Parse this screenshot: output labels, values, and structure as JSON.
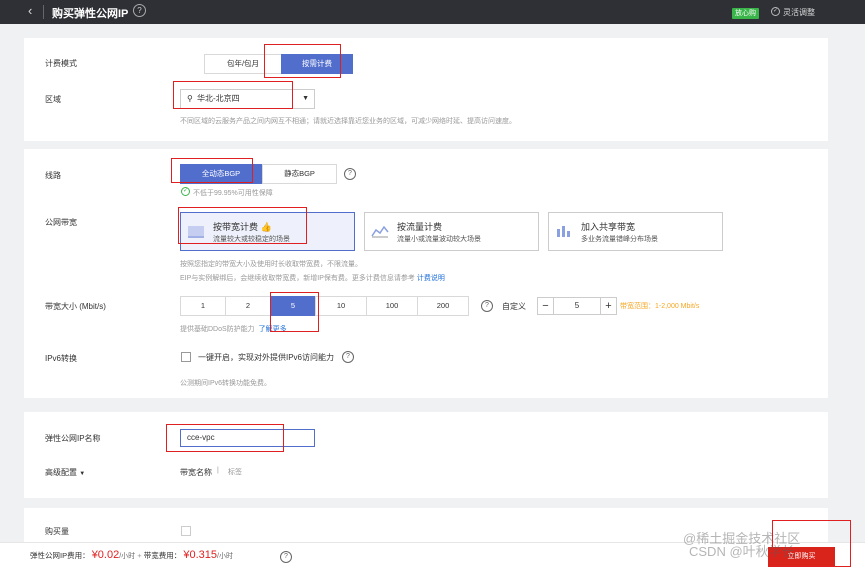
{
  "header": {
    "back_glyph": "‹",
    "title": "购买弹性公网IP",
    "help_glyph": "?",
    "badge": "放心购",
    "flex_adjust": "灵活调整"
  },
  "billing": {
    "label": "计费模式",
    "options": [
      "包年/包月",
      "按需计费"
    ],
    "selected": "按需计费"
  },
  "region": {
    "label": "区域",
    "value": "华北-北京四",
    "hint": "不同区域的云服务产品之间内网互不相通；请就近选择靠近您业务的区域，可减少网络时延、提高访问速度。"
  },
  "line": {
    "label": "线路",
    "options": [
      "全动态BGP",
      "静态BGP"
    ],
    "selected": "全动态BGP",
    "sla": "不低于99.95%可用性保障"
  },
  "bandwidth": {
    "label": "公网带宽",
    "options": [
      {
        "title": "按带宽计费",
        "desc": "流量较大或较稳定的场景"
      },
      {
        "title": "按流量计费",
        "desc": "流量小或流量波动较大场景"
      },
      {
        "title": "加入共享带宽",
        "desc": "多业务流量错峰分布场景"
      }
    ],
    "hint1": "按照您指定的带宽大小及使用时长收取带宽费，不限流量。",
    "hint2": "EIP与实例解绑后，会继续收取带宽费，新增IP保有费。更多计费信息请参考",
    "hint2_link": "计费说明"
  },
  "size": {
    "label": "带宽大小 (Mbit/s)",
    "options": [
      "1",
      "2",
      "5",
      "10",
      "100",
      "200"
    ],
    "selected": "5",
    "custom_label": "自定义",
    "custom_value": "5",
    "minus": "−",
    "plus": "+",
    "range": "带宽范围：1-2,000 Mbit/s",
    "ddos_hint": "提供基础DDoS防护能力",
    "ddos_link": "了解更多"
  },
  "ipv6": {
    "label": "IPv6转换",
    "checkbox_label": "一键开启，实现对外提供IPv6访问能力",
    "hint": "公测期间IPv6转换功能免费。"
  },
  "eip_name": {
    "label": "弹性公网IP名称",
    "value": "cce-vpc"
  },
  "advanced": {
    "label": "高级配置",
    "caret": "▼",
    "bandwidth_name": "带宽名称",
    "divider": "|",
    "tag": "标签"
  },
  "quantity": {
    "label": "购买量"
  },
  "footer": {
    "eip_fee_label": "弹性公网IP费用：",
    "eip_fee": "¥0.02",
    "per_hour": "/小时",
    "plus": "+",
    "bw_fee_label": "带宽费用：",
    "bw_fee": "¥0.315",
    "buy_button": "立即购买"
  },
  "watermarks": {
    "line1": "@稀土掘金技术社区",
    "line2": "CSDN @叶秋学长"
  }
}
